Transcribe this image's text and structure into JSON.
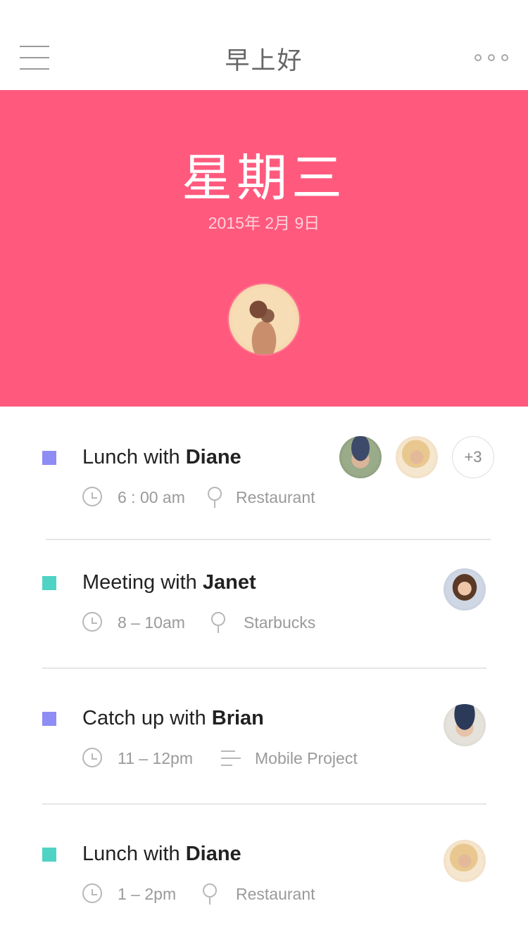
{
  "header": {
    "title": "早上好",
    "menu_icon": "hamburger-menu-icon",
    "more_icon": "more-dots-icon"
  },
  "hero": {
    "weekday": "星期三",
    "date": "2015年 2月 9日",
    "accent_color": "#ff5a7e"
  },
  "events": [
    {
      "title_prefix": "Lunch with ",
      "title_name": "Diane",
      "category_color": "#8e8cf5",
      "time": "6 : 00 am",
      "detail_icon": "location-pin-icon",
      "detail": "Restaurant",
      "extra_attendees": "+3"
    },
    {
      "title_prefix": "Meeting with ",
      "title_name": "Janet",
      "category_color": "#4fd3c4",
      "time": "8 – 10am",
      "detail_icon": "location-pin-icon",
      "detail": "Starbucks"
    },
    {
      "title_prefix": "Catch up with ",
      "title_name": "Brian",
      "category_color": "#8e8cf5",
      "time": "11 – 12pm",
      "detail_icon": "notes-lines-icon",
      "detail": "Mobile Project"
    },
    {
      "title_prefix": "Lunch with ",
      "title_name": "Diane",
      "category_color": "#4fd3c4",
      "time": "1 – 2pm",
      "detail_icon": "location-pin-icon",
      "detail": "Restaurant"
    }
  ]
}
